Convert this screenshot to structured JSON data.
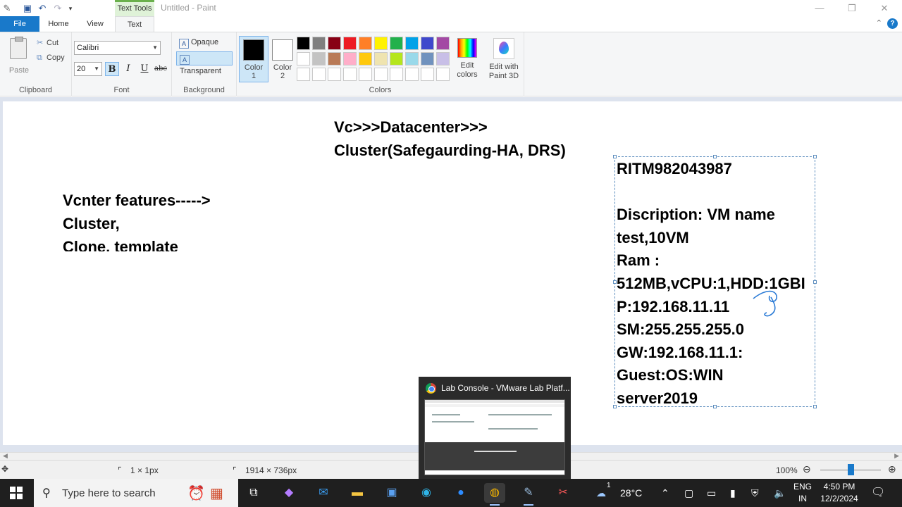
{
  "window": {
    "title": "Untitled - Paint",
    "context_tab": "Text Tools",
    "controls": {
      "minimize": "—",
      "restore": "❐",
      "close": "✕"
    }
  },
  "ribbon_tabs": {
    "file": "File",
    "home": "Home",
    "view": "View",
    "text": "Text",
    "help": "?"
  },
  "clipboard": {
    "paste": "Paste",
    "cut": "Cut",
    "copy": "Copy",
    "label": "Clipboard"
  },
  "font": {
    "family": "Calibri",
    "size": "20",
    "bold": "B",
    "italic": "I",
    "underline": "U",
    "strikethrough": "abc",
    "label": "Font"
  },
  "background": {
    "opaque": "Opaque",
    "transparent": "Transparent",
    "label": "Background"
  },
  "colors": {
    "color1_label": "Color",
    "color1_num": "1",
    "color2_label": "Color",
    "color2_num": "2",
    "color1": "#000000",
    "color2": "#ffffff",
    "edit_colors": "Edit colors",
    "edit_paint3d": "Edit with Paint 3D",
    "label": "Colors",
    "palette": [
      [
        "#000000",
        "#7f7f7f",
        "#880015",
        "#ed1c24",
        "#ff7f27",
        "#fff200",
        "#22b14c",
        "#00a2e8",
        "#3f48cc",
        "#a349a4"
      ],
      [
        "#ffffff",
        "#c3c3c3",
        "#b97a57",
        "#ffaec9",
        "#ffc90e",
        "#efe4b0",
        "#b5e61d",
        "#99d9ea",
        "#7092be",
        "#c8bfe7"
      ],
      [
        "#ffffff",
        "#ffffff",
        "#ffffff",
        "#ffffff",
        "#ffffff",
        "#ffffff",
        "#ffffff",
        "#ffffff",
        "#ffffff",
        "#ffffff"
      ]
    ]
  },
  "canvas_text": {
    "top_line1": "Vc>>>Datacenter>>>",
    "top_line2": "Cluster(Safegaurding-HA, DRS)",
    "left_line1": "Vcnter features----->",
    "left_line2": "Cluster,",
    "left_line3": "Clone, template",
    "box_lines": [
      "RITM982043987",
      "",
      "Discription: VM name",
      "test,10VM",
      "Ram :",
      "512MB,vCPU:1,HDD:1GBI",
      "P:192.168.11.11",
      "SM:255.255.255.0",
      "GW:192.168.11.1:",
      "Guest:OS:WIN",
      "server2019"
    ]
  },
  "status": {
    "selection": "1 × 1px",
    "canvas_size": "1914 × 736px",
    "zoom": "100%",
    "zoom_level_percent": 100
  },
  "preview": {
    "title": "Lab Console - VMware Lab Platf..."
  },
  "taskbar": {
    "search_placeholder": "Type here to search",
    "weather_temp": "28°C",
    "weather_badge": "1",
    "lang_line1": "ENG",
    "lang_line2": "IN",
    "time": "4:50 PM",
    "date": "12/2/2024"
  }
}
